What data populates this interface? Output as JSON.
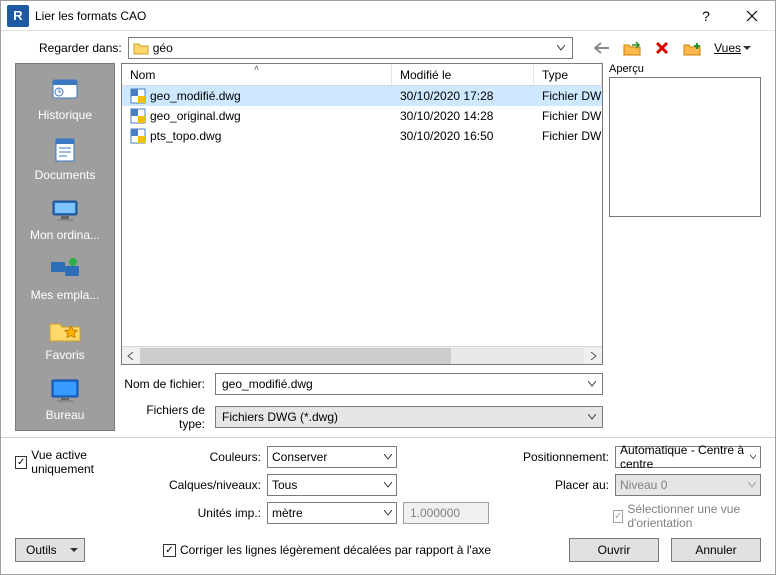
{
  "title": "Lier les formats CAO",
  "look_in_label": "Regarder dans:",
  "look_in_value": "géo",
  "views_label": "Vues",
  "preview_label": "Aperçu",
  "places": [
    {
      "label": "Historique"
    },
    {
      "label": "Documents"
    },
    {
      "label": "Mon ordina..."
    },
    {
      "label": "Mes empla..."
    },
    {
      "label": "Favoris"
    },
    {
      "label": "Bureau"
    }
  ],
  "columns": {
    "name": "Nom",
    "modified": "Modifié le",
    "type": "Type"
  },
  "files": [
    {
      "name": "geo_modifié.dwg",
      "modified": "30/10/2020 17:28",
      "type": "Fichier DW",
      "selected": true
    },
    {
      "name": "geo_original.dwg",
      "modified": "30/10/2020 14:28",
      "type": "Fichier DW",
      "selected": false
    },
    {
      "name": "pts_topo.dwg",
      "modified": "30/10/2020 16:50",
      "type": "Fichier DW",
      "selected": false
    }
  ],
  "filename_label": "Nom de fichier:",
  "filename_value": "geo_modifié.dwg",
  "filter_label": "Fichiers de type:",
  "filter_value": "Fichiers DWG  (*.dwg)",
  "active_view_only": "Vue active uniquement",
  "colors_label": "Couleurs:",
  "colors_value": "Conserver",
  "layers_label": "Calques/niveaux:",
  "layers_value": "Tous",
  "units_label": "Unités imp.:",
  "units_value": "mètre",
  "units_factor": "1.000000",
  "correct_lines": "Corriger les lignes légèrement décalées par rapport à l'axe",
  "positioning_label": "Positionnement:",
  "positioning_value": "Automatique - Centre à centre",
  "placeat_label": "Placer au:",
  "placeat_value": "Niveau 0",
  "orient_view": "Sélectionner une vue d'orientation",
  "tools_label": "Outils",
  "open_label": "Ouvrir",
  "cancel_label": "Annuler"
}
